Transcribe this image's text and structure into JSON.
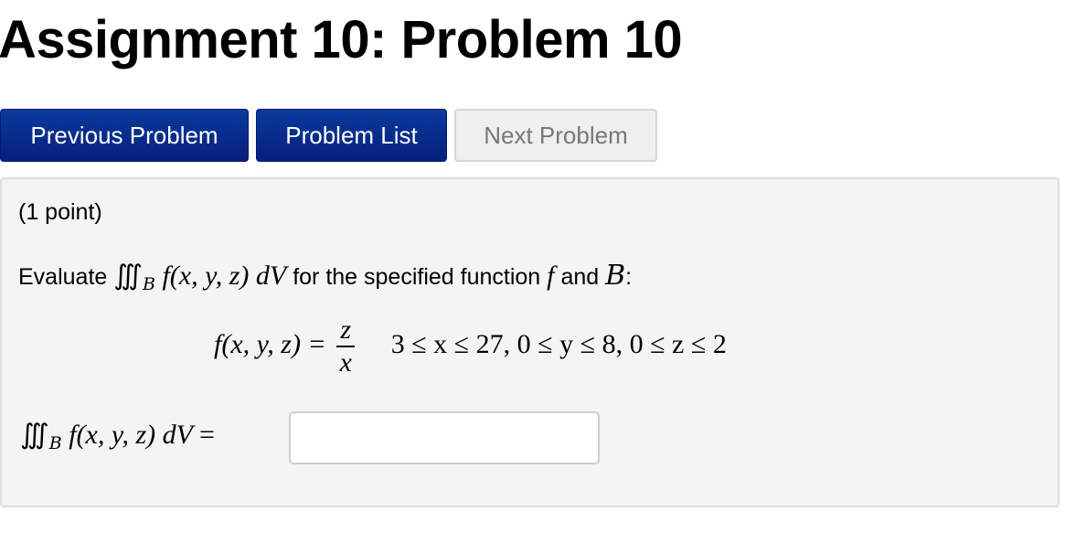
{
  "page": {
    "title": "Assignment 10: Problem 10"
  },
  "nav": {
    "previous_label": "Previous Problem",
    "list_label": "Problem List",
    "next_label": "Next Problem",
    "next_disabled": true
  },
  "problem": {
    "points": "(1 point)",
    "intro_prefix": "Evaluate",
    "integral_symbol": "∭",
    "region_symbol": "B",
    "integrand": "f(x, y, z)",
    "differential": "dV",
    "intro_middle": "for the specified function",
    "f_symbol": "f",
    "intro_and": "and",
    "intro_suffix": ":",
    "function_lhs": "f(x, y, z) =",
    "function_numerator": "z",
    "function_denominator": "x",
    "region_bounds": "3 ≤ x ≤ 27, 0 ≤ y ≤ 8, 0 ≤ z ≤ 2",
    "answer_equals": "=",
    "answer_value": ""
  },
  "colors": {
    "button_primary": "#0b2e8f",
    "button_disabled": "#efefef",
    "panel_bg": "#f4f4f4"
  }
}
